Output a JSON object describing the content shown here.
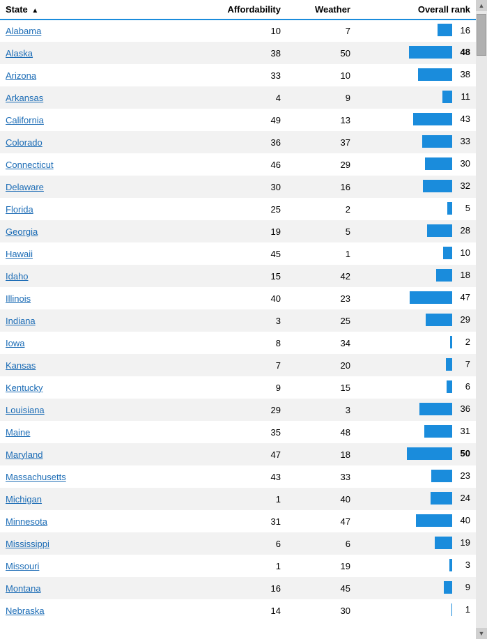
{
  "header": {
    "state_label": "State",
    "afford_label": "Affordability",
    "weather_label": "Weather",
    "rank_label": "Overall rank"
  },
  "rows": [
    {
      "state": "Alabama",
      "afford": 10,
      "weather": 7,
      "rank": 16,
      "bold": false
    },
    {
      "state": "Alaska",
      "afford": 38,
      "weather": 50,
      "rank": 48,
      "bold": true
    },
    {
      "state": "Arizona",
      "afford": 33,
      "weather": 10,
      "rank": 38,
      "bold": false
    },
    {
      "state": "Arkansas",
      "afford": 4,
      "weather": 9,
      "rank": 11,
      "bold": false
    },
    {
      "state": "California",
      "afford": 49,
      "weather": 13,
      "rank": 43,
      "bold": false
    },
    {
      "state": "Colorado",
      "afford": 36,
      "weather": 37,
      "rank": 33,
      "bold": false
    },
    {
      "state": "Connecticut",
      "afford": 46,
      "weather": 29,
      "rank": 30,
      "bold": false
    },
    {
      "state": "Delaware",
      "afford": 30,
      "weather": 16,
      "rank": 32,
      "bold": false
    },
    {
      "state": "Florida",
      "afford": 25,
      "weather": 2,
      "rank": 5,
      "bold": false
    },
    {
      "state": "Georgia",
      "afford": 19,
      "weather": 5,
      "rank": 28,
      "bold": false
    },
    {
      "state": "Hawaii",
      "afford": 45,
      "weather": 1,
      "rank": 10,
      "bold": false
    },
    {
      "state": "Idaho",
      "afford": 15,
      "weather": 42,
      "rank": 18,
      "bold": false
    },
    {
      "state": "Illinois",
      "afford": 40,
      "weather": 23,
      "rank": 47,
      "bold": false
    },
    {
      "state": "Indiana",
      "afford": 3,
      "weather": 25,
      "rank": 29,
      "bold": false
    },
    {
      "state": "Iowa",
      "afford": 8,
      "weather": 34,
      "rank": 2,
      "bold": false
    },
    {
      "state": "Kansas",
      "afford": 7,
      "weather": 20,
      "rank": 7,
      "bold": false
    },
    {
      "state": "Kentucky",
      "afford": 9,
      "weather": 15,
      "rank": 6,
      "bold": false
    },
    {
      "state": "Louisiana",
      "afford": 29,
      "weather": 3,
      "rank": 36,
      "bold": false
    },
    {
      "state": "Maine",
      "afford": 35,
      "weather": 48,
      "rank": 31,
      "bold": false
    },
    {
      "state": "Maryland",
      "afford": 47,
      "weather": 18,
      "rank": 50,
      "bold": true
    },
    {
      "state": "Massachusetts",
      "afford": 43,
      "weather": 33,
      "rank": 23,
      "bold": false
    },
    {
      "state": "Michigan",
      "afford": 1,
      "weather": 40,
      "rank": 24,
      "bold": false
    },
    {
      "state": "Minnesota",
      "afford": 31,
      "weather": 47,
      "rank": 40,
      "bold": false
    },
    {
      "state": "Mississippi",
      "afford": 6,
      "weather": 6,
      "rank": 19,
      "bold": false
    },
    {
      "state": "Missouri",
      "afford": 1,
      "weather": 19,
      "rank": 3,
      "bold": false
    },
    {
      "state": "Montana",
      "afford": 16,
      "weather": 45,
      "rank": 9,
      "bold": false
    },
    {
      "state": "Nebraska",
      "afford": 14,
      "weather": 30,
      "rank": 1,
      "bold": false
    }
  ],
  "maxRank": 50,
  "barMaxWidth": 65
}
